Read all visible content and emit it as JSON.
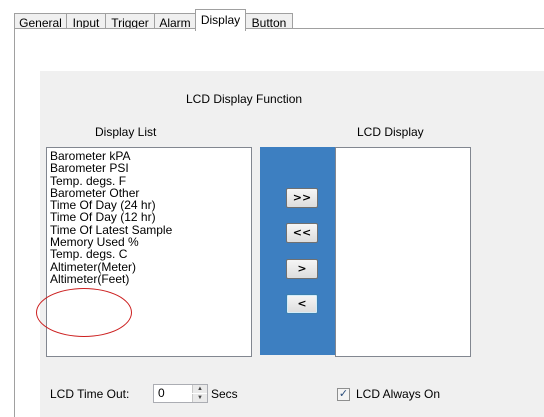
{
  "tabs": [
    {
      "label": "General"
    },
    {
      "label": "Input"
    },
    {
      "label": "Trigger"
    },
    {
      "label": "Alarm"
    },
    {
      "label": "Display"
    },
    {
      "label": "Button"
    }
  ],
  "section_title": "LCD Display Function",
  "display_list": {
    "label": "Display List",
    "items": [
      "Barometer kPA",
      "Barometer PSI",
      "Temp. degs. F",
      "Barometer Other",
      "Time Of Day (24 hr)",
      "Time Of Day (12 hr)",
      "Time Of Latest Sample",
      "Memory Used %",
      "Temp. degs. C",
      "Altimeter(Meter)",
      "Altimeter(Feet)"
    ]
  },
  "lcd_display": {
    "label": "LCD Display",
    "items": []
  },
  "buttons": {
    "add_all": ">>",
    "remove_all": "<<",
    "add": ">",
    "remove": "<"
  },
  "timeout": {
    "label": "LCD Time Out:",
    "value": "0",
    "unit": "Secs"
  },
  "always_on": {
    "label": "LCD Always On",
    "checked": true
  },
  "colors": {
    "accent": "#3d7fc1",
    "highlight": "#cc1f1f"
  }
}
